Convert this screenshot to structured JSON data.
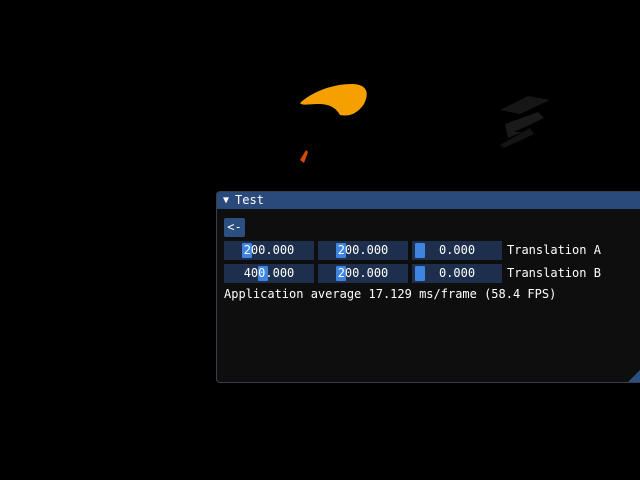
{
  "window": {
    "title": "Test",
    "collapse_icon": "triangle-down-icon"
  },
  "back_button": {
    "label": "<-"
  },
  "translation_a": {
    "label": "Translation A",
    "values": [
      "200.000",
      "200.000",
      "0.000"
    ]
  },
  "translation_b": {
    "label": "Translation B",
    "values": [
      "400.000",
      "200.000",
      "0.000"
    ]
  },
  "status": {
    "fps_text": "Application average 17.129 ms/frame (58.4 FPS)"
  },
  "colors": {
    "background": "#000000",
    "title_bar": "#294a7a",
    "frame_bg": "#1d2f4d",
    "slider_grab": "#3d85e0",
    "button": "#2a4f80",
    "shape_orange": "#f5a000",
    "shape_dark_orange": "#d84a00",
    "shape_dark": "#1a1a1a"
  }
}
